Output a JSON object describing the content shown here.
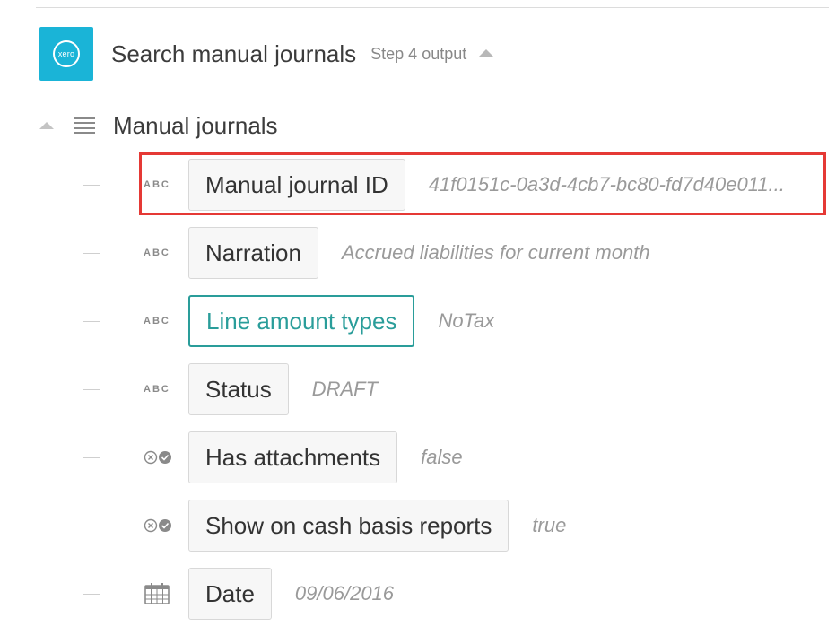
{
  "header": {
    "logo_text": "xero",
    "title": "Search manual journals",
    "step": "Step 4 output"
  },
  "group": {
    "label": "Manual journals"
  },
  "fields": [
    {
      "type": "ABC",
      "icon": "text-type-icon",
      "label": "Manual journal ID",
      "value": "41f0151c-0a3d-4cb7-bc80-fd7d40e011..."
    },
    {
      "type": "ABC",
      "icon": "text-type-icon",
      "label": "Narration",
      "value": "Accrued liabilities for current month"
    },
    {
      "type": "ABC",
      "icon": "text-type-icon",
      "label": "Line amount types",
      "value": "NoTax"
    },
    {
      "type": "ABC",
      "icon": "text-type-icon",
      "label": "Status",
      "value": "DRAFT"
    },
    {
      "type": "",
      "icon": "boolean-type-icon",
      "label": "Has attachments",
      "value": "false"
    },
    {
      "type": "",
      "icon": "boolean-type-icon",
      "label": "Show on cash basis reports",
      "value": "true"
    },
    {
      "type": "",
      "icon": "calendar-icon",
      "label": "Date",
      "value": "09/06/2016"
    }
  ],
  "colors": {
    "brand": "#1ab4d7",
    "active": "#2a9d9a",
    "highlight": "#e53935"
  }
}
